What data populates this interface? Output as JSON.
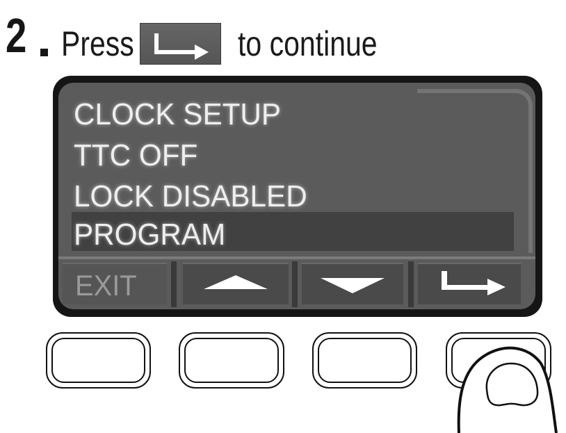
{
  "header": {
    "step_number": "2",
    "press_word": "Press",
    "continue_text": "to continue",
    "inline_key_icon": "enter-arrow-icon"
  },
  "display": {
    "menu_items": [
      {
        "label": "CLOCK SETUP",
        "selected": false
      },
      {
        "label": "TTC OFF",
        "selected": false
      },
      {
        "label": "LOCK DISABLED",
        "selected": false
      },
      {
        "label": "PROGRAM",
        "selected": true
      }
    ],
    "softkeys": [
      {
        "label": "EXIT",
        "icon": null
      },
      {
        "label": "",
        "icon": "up-arrow-icon"
      },
      {
        "label": "",
        "icon": "down-arrow-icon"
      },
      {
        "label": "",
        "icon": "enter-arrow-icon"
      }
    ]
  },
  "colors": {
    "screen": "#5b5b5b",
    "bezel": "#151515",
    "highlight": "#414141",
    "text": "#eeeeee"
  }
}
